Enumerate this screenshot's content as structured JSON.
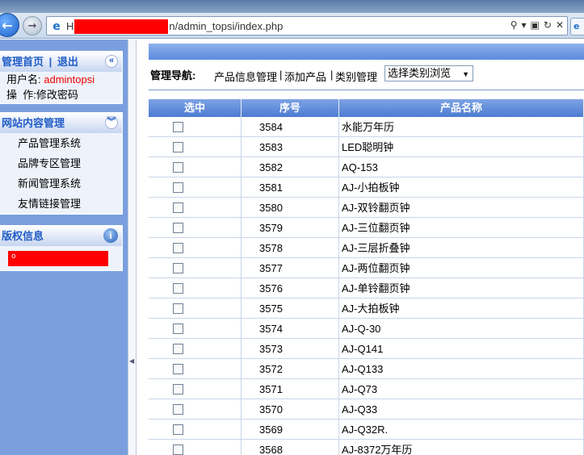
{
  "browser": {
    "url_prefix": "H",
    "url_suffix": "n/admin_topsi/index.php",
    "tab_icon": "e"
  },
  "sidebar": {
    "header1": {
      "home_link": "管理首页",
      "separator": "|",
      "logout_link": "退出"
    },
    "user": {
      "name_label": "用户名:",
      "name_value": "admintopsi",
      "action_label": "操  作:",
      "action_link": "修改密码"
    },
    "site_section": {
      "title": "网站内容管理",
      "items": [
        "产品管理系统",
        "品牌专区管理",
        "新闻管理系统",
        "友情链接管理"
      ]
    },
    "copyright": {
      "title": "版权信息",
      "redacted_text": "o"
    }
  },
  "main": {
    "nav": {
      "label": "管理导航:",
      "links": [
        "产品信息管理",
        "添加产品",
        "类别管理"
      ],
      "category_select": "选择类别浏览"
    },
    "table": {
      "headers": [
        "选中",
        "序号",
        "产品名称"
      ],
      "rows": [
        {
          "id": "3584",
          "name": "水能万年历"
        },
        {
          "id": "3583",
          "name": "LED聪明钟"
        },
        {
          "id": "3582",
          "name": "AQ-153"
        },
        {
          "id": "3581",
          "name": "AJ-小拍板钟"
        },
        {
          "id": "3580",
          "name": "AJ-双铃翻页钟"
        },
        {
          "id": "3579",
          "name": "AJ-三位翻页钟"
        },
        {
          "id": "3578",
          "name": "AJ-三层折叠钟"
        },
        {
          "id": "3577",
          "name": "AJ-两位翻页钟"
        },
        {
          "id": "3576",
          "name": "AJ-单铃翻页钟"
        },
        {
          "id": "3575",
          "name": "AJ-大拍板钟"
        },
        {
          "id": "3574",
          "name": "AJ-Q-30"
        },
        {
          "id": "3573",
          "name": "AJ-Q141"
        },
        {
          "id": "3572",
          "name": "AJ-Q133"
        },
        {
          "id": "3571",
          "name": "AJ-Q73"
        },
        {
          "id": "3570",
          "name": "AJ-Q33"
        },
        {
          "id": "3569",
          "name": "AJ-Q32R."
        },
        {
          "id": "3568",
          "name": "AJ-8372万年历"
        }
      ]
    }
  }
}
